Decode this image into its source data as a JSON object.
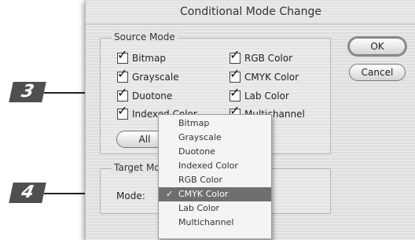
{
  "dialog": {
    "title": "Conditional Mode Change",
    "ok_label": "OK",
    "cancel_label": "Cancel"
  },
  "source_mode": {
    "label": "Source Mode",
    "checkboxes": [
      {
        "label": "Bitmap",
        "checked": true
      },
      {
        "label": "RGB Color",
        "checked": true
      },
      {
        "label": "Grayscale",
        "checked": true
      },
      {
        "label": "CMYK Color",
        "checked": true
      },
      {
        "label": "Duotone",
        "checked": true
      },
      {
        "label": "Lab Color",
        "checked": true
      },
      {
        "label": "Indexed Color",
        "checked": true
      },
      {
        "label": "Multichannel",
        "checked": true
      }
    ],
    "all_button": "All"
  },
  "target_mode": {
    "label": "Target Mode",
    "mode_label": "Mode:",
    "selected": "CMYK Color",
    "options": [
      "Bitmap",
      "Grayscale",
      "Duotone",
      "Indexed Color",
      "RGB Color",
      "CMYK Color",
      "Lab Color",
      "Multichannel"
    ]
  },
  "callouts": [
    "3",
    "4"
  ],
  "colors": {
    "callout_bg": "#4f4f4f",
    "menu_selected": "#6f6f6f",
    "dialog_bg": "#e4e4e4"
  },
  "icons": {
    "checkmark": "check-icon",
    "arrow": "arrow-right-icon"
  }
}
